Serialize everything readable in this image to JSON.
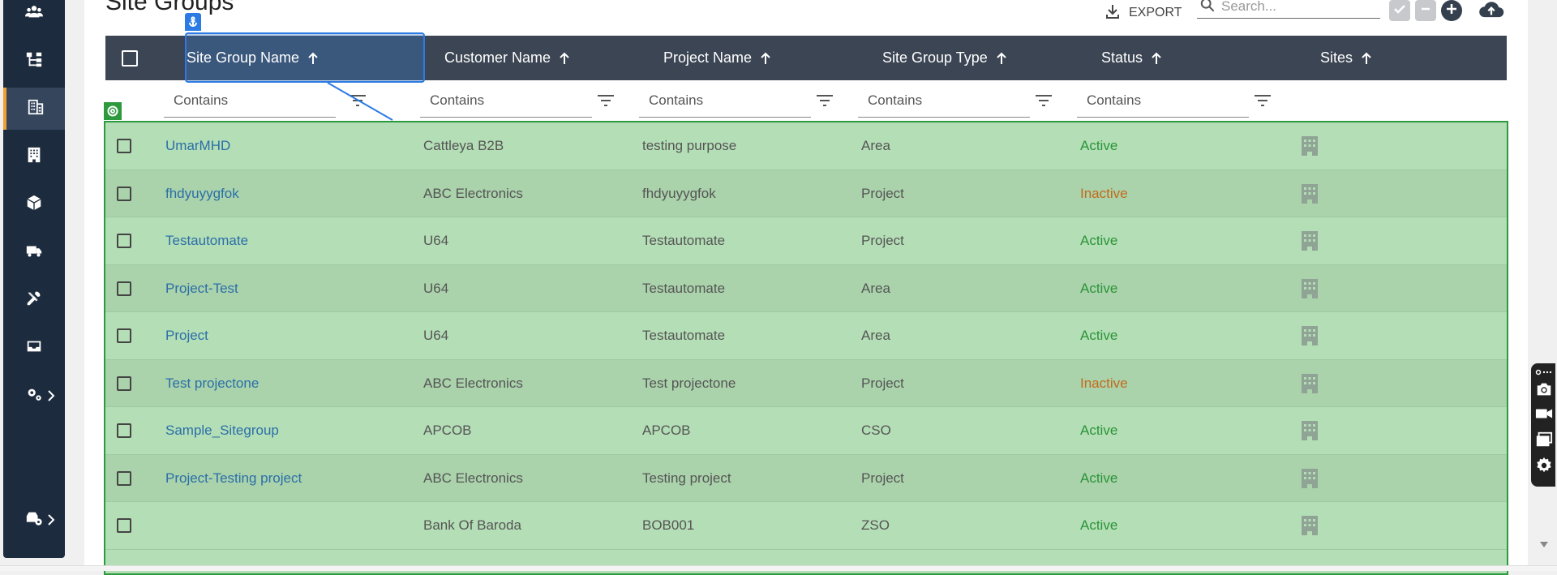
{
  "page": {
    "title": "Site Groups"
  },
  "toolbar": {
    "export_label": "EXPORT",
    "search_placeholder": "Search..."
  },
  "sidebar": {
    "items": [
      {
        "name": "users-icon"
      },
      {
        "name": "hierarchy-icon"
      },
      {
        "name": "building-icon",
        "active": true
      },
      {
        "name": "office-icon"
      },
      {
        "name": "package-icon"
      },
      {
        "name": "truck-icon"
      },
      {
        "name": "tools-icon"
      },
      {
        "name": "inbox-icon"
      },
      {
        "name": "settings-icon"
      },
      {
        "name": "vehicle-settings-icon"
      }
    ]
  },
  "table": {
    "columns": [
      "Site Group Name",
      "Customer Name",
      "Project Name",
      "Site Group Type",
      "Status",
      "Sites"
    ],
    "filter_placeholder": "Contains",
    "rows": [
      {
        "name": "UmarMHD",
        "customer": "Cattleya B2B",
        "project": "testing purpose",
        "type": "Area",
        "status": "Active"
      },
      {
        "name": "fhdyuyygfok",
        "customer": "ABC Electronics",
        "project": "fhdyuyygfok",
        "type": "Project",
        "status": "Inactive"
      },
      {
        "name": "Testautomate",
        "customer": "U64",
        "project": "Testautomate",
        "type": "Project",
        "status": "Active"
      },
      {
        "name": "Project-Test",
        "customer": "U64",
        "project": "Testautomate",
        "type": "Area",
        "status": "Active"
      },
      {
        "name": "Project",
        "customer": "U64",
        "project": "Testautomate",
        "type": "Area",
        "status": "Active"
      },
      {
        "name": "Test projectone",
        "customer": "ABC Electronics",
        "project": "Test projectone",
        "type": "Project",
        "status": "Inactive"
      },
      {
        "name": "Sample_Sitegroup",
        "customer": "APCOB",
        "project": "APCOB",
        "type": "CSO",
        "status": "Active"
      },
      {
        "name": "Project-Testing project",
        "customer": "ABC Electronics",
        "project": "Testing project",
        "type": "Project",
        "status": "Active"
      },
      {
        "name": "",
        "customer": "Bank Of Baroda",
        "project": "BOB001",
        "type": "ZSO",
        "status": "Active"
      }
    ]
  },
  "colors": {
    "sidebar_bg": "#1d2b3e",
    "header_bg": "#3c4554",
    "row_highlight": "#b4deb6",
    "active": "#2a9438",
    "inactive": "#c46a1a",
    "link": "#2b6fa8"
  }
}
